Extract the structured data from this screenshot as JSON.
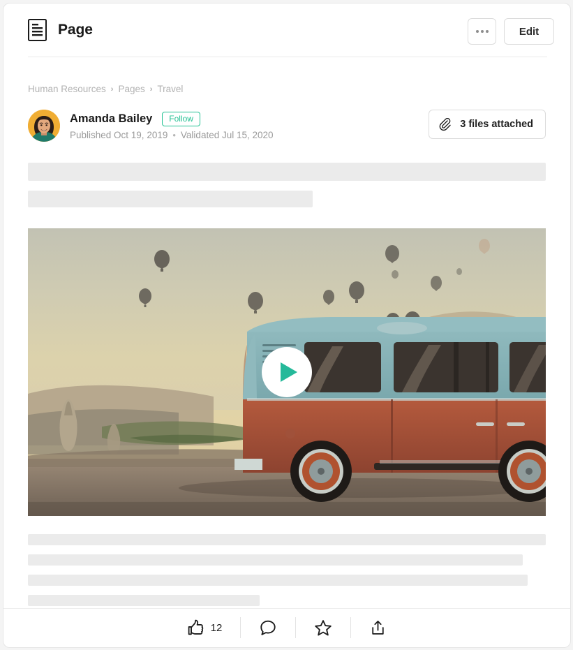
{
  "window": {
    "header": {
      "icon": "document-icon",
      "title": "Page",
      "more_button_label": "",
      "edit_button_label": "Edit"
    }
  },
  "breadcrumb": {
    "separator": "›",
    "items": [
      {
        "label": "Human Resources"
      },
      {
        "label": "Pages"
      },
      {
        "label": "Travel"
      }
    ]
  },
  "author": {
    "avatar_alt": "Amanda Bailey avatar",
    "name": "Amanda Bailey",
    "follow_label": "Follow",
    "published_text": "Published Oct 19, 2019",
    "separator": "•",
    "validated_text": "Validated Jul 15, 2020"
  },
  "attachments": {
    "icon": "paperclip-icon",
    "label": "3 files attached"
  },
  "media": {
    "type": "video-thumbnail",
    "play_icon": "play-icon",
    "description": "Vintage teal and rust VW camper van at sunrise with hot air balloons over Cappadocia"
  },
  "actions": {
    "like": {
      "icon": "thumbs-up-icon",
      "count": "12"
    },
    "comment": {
      "icon": "comment-icon"
    },
    "favorite": {
      "icon": "star-icon"
    },
    "share": {
      "icon": "share-icon"
    }
  },
  "colors": {
    "accent_teal": "#23c193",
    "play_green": "#25b99a",
    "skeleton_gray": "#ebebeb",
    "border_gray": "#dcdcdc",
    "text_muted": "#9a9a9a",
    "avatar_bg": "#f0ad33"
  }
}
